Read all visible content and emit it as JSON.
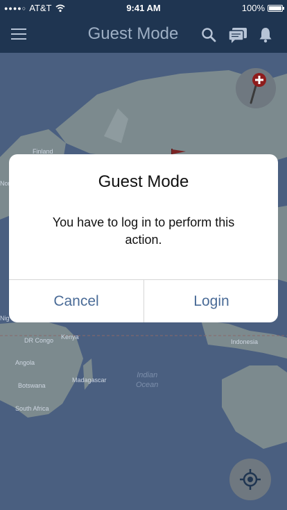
{
  "status_bar": {
    "carrier": "AT&T",
    "time": "9:41 AM",
    "battery": "100%"
  },
  "nav": {
    "title": "Guest Mode"
  },
  "map": {
    "labels": {
      "finland": "Finland",
      "dr_congo": "DR Congo",
      "kenya": "Kenya",
      "angola": "Angola",
      "botswana": "Botswana",
      "madagascar": "Madagascar",
      "south_africa": "South Africa",
      "indonesia": "Indonesia",
      "nor": "Nor",
      "nig": "Nig",
      "indian": "Indian",
      "ocean": "Ocean"
    }
  },
  "dialog": {
    "title": "Guest Mode",
    "message": "You have to log in to perform this action.",
    "cancel_label": "Cancel",
    "login_label": "Login"
  },
  "icons": {
    "menu": "menu-icon",
    "search": "search-icon",
    "chat": "chat-icon",
    "bell": "bell-icon",
    "add_pin": "add-pin-icon",
    "locate": "crosshair-icon",
    "wifi": "wifi-icon",
    "battery": "battery-icon",
    "flag": "flag-icon"
  },
  "colors": {
    "nav_background": "#1f3551",
    "nav_title": "#9eafc4",
    "dialog_button_text": "#4a6b97",
    "map_water": "#4a5f80",
    "map_land": "#7c8a8e"
  }
}
